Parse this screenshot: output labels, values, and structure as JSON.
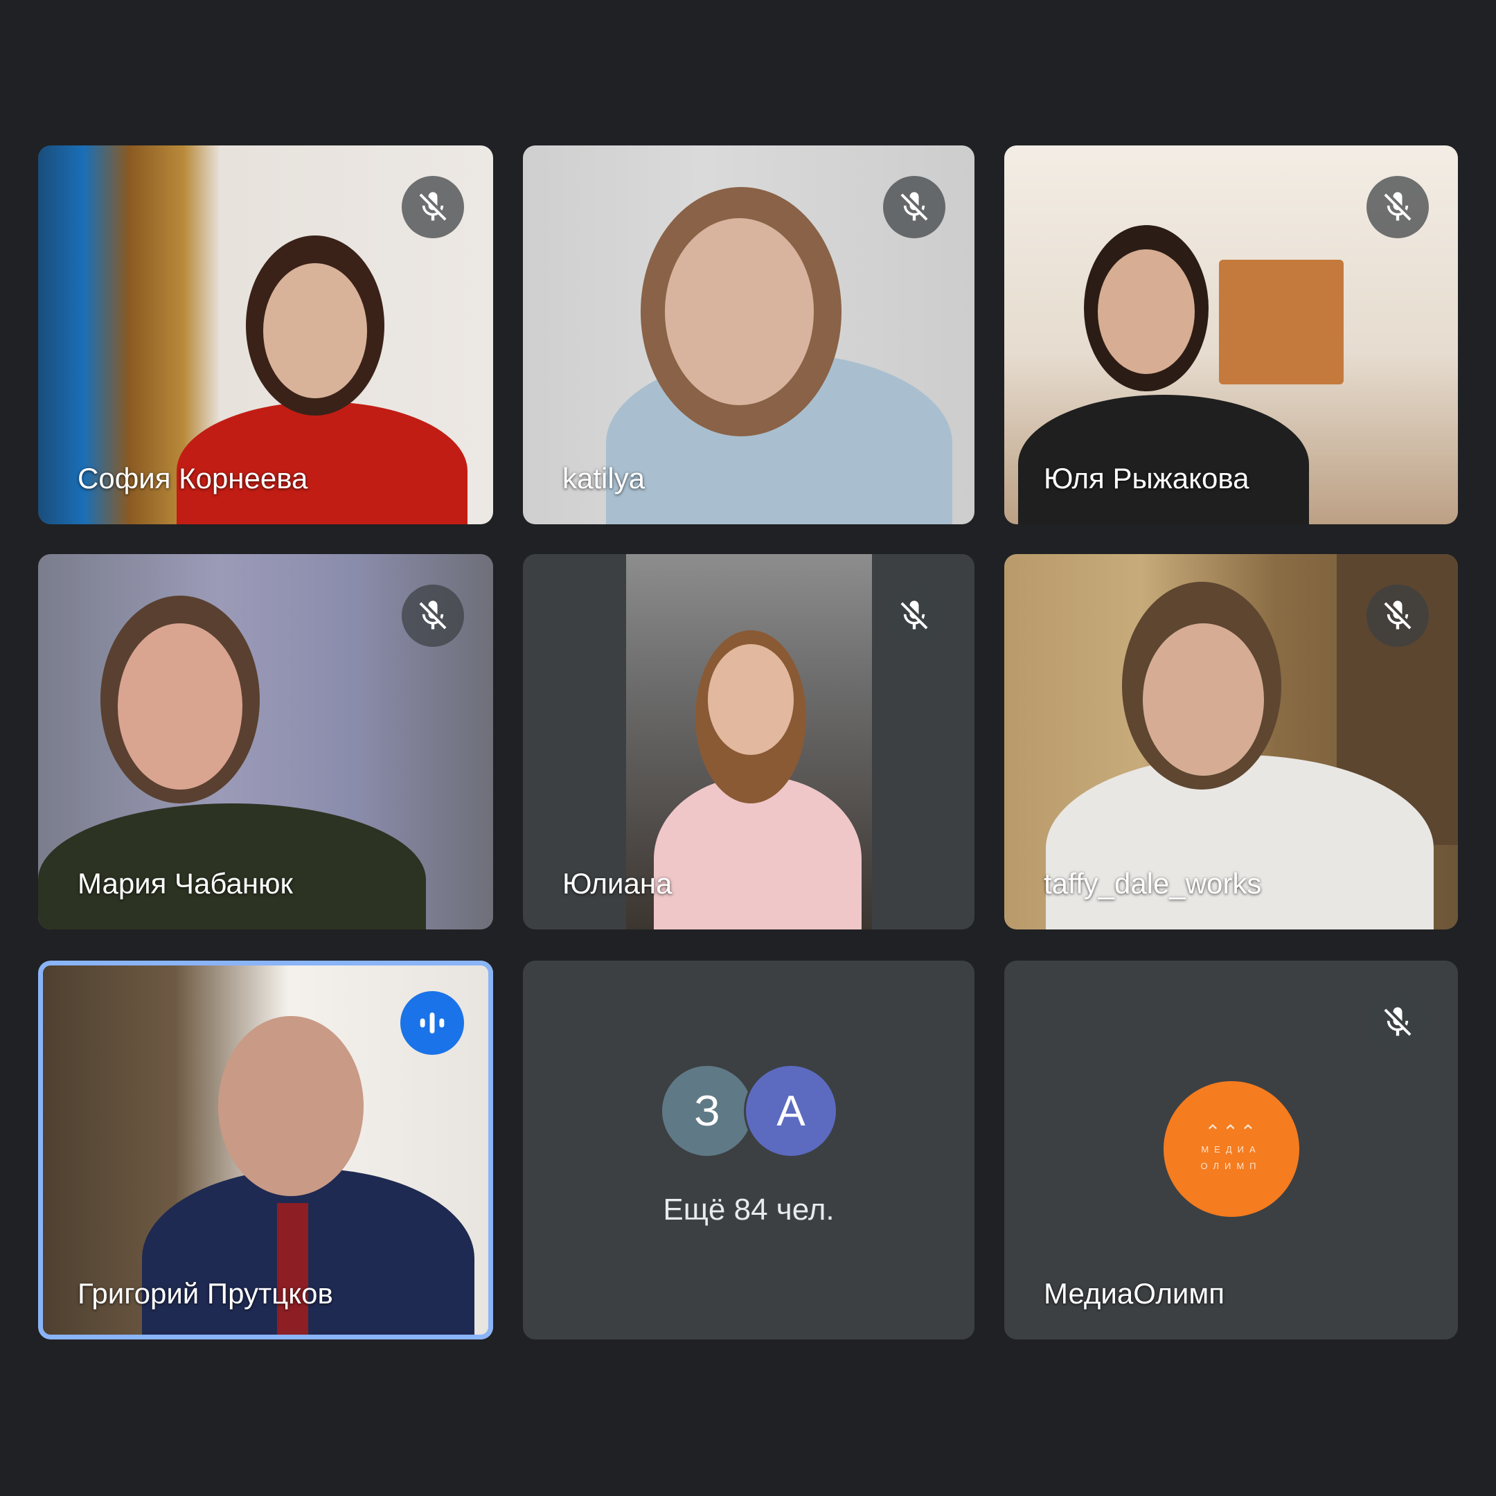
{
  "participants": [
    {
      "name": "София Корнеева",
      "muted": true
    },
    {
      "name": "katilya",
      "muted": true
    },
    {
      "name": "Юля Рыжакова",
      "muted": true
    },
    {
      "name": "Мария Чабанюк",
      "muted": true
    },
    {
      "name": "Юлиана",
      "muted": true
    },
    {
      "name": "taffy_dale_works",
      "muted": true
    },
    {
      "name": "Григорий Прутцков",
      "muted": false,
      "speaking": true
    }
  ],
  "more_tile": {
    "avatars": [
      "З",
      "А"
    ],
    "label": "Ещё 84 чел."
  },
  "media_tile": {
    "name": "МедиаОлимп",
    "muted": true,
    "logo_line1": "МЕДИА",
    "logo_line2": "ОЛИМП"
  },
  "colors": {
    "background": "#202124",
    "tile": "#3c4043",
    "active_border": "#8ab4f8",
    "speaking": "#1a73e8",
    "logo": "#f57c1f"
  },
  "icons": {
    "mic_off": "mic-off-icon",
    "speaking": "speaking-indicator-icon"
  }
}
